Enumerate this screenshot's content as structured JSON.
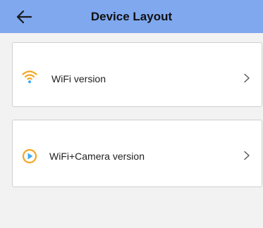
{
  "header": {
    "title": "Device Layout",
    "back_icon": "arrow-left-icon",
    "background": "#7fa8ef"
  },
  "options": [
    {
      "label": "WiFi version",
      "icon": "wifi-icon",
      "icon_color": "#f5a623"
    },
    {
      "label": "WiFi+Camera version",
      "icon": "play-circle-icon",
      "icon_color": "#f5a623"
    }
  ]
}
